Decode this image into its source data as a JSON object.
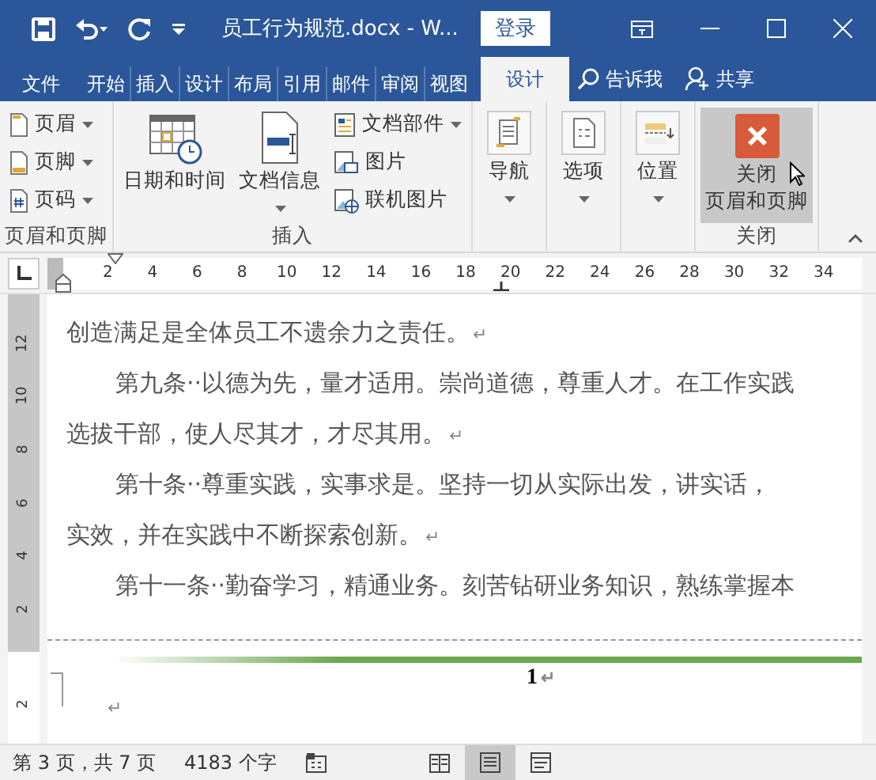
{
  "window": {
    "title": "员工行为规范.docx  -  W...",
    "sign_in": "登录"
  },
  "tabs": [
    {
      "label": "文件",
      "selected": false
    },
    {
      "label": "开始",
      "selected": false
    },
    {
      "label": "插入",
      "selected": false
    },
    {
      "label": "设计",
      "selected": false
    },
    {
      "label": "布局",
      "selected": false
    },
    {
      "label": "引用",
      "selected": false
    },
    {
      "label": "邮件",
      "selected": false
    },
    {
      "label": "审阅",
      "selected": false
    },
    {
      "label": "视图",
      "selected": false
    },
    {
      "label": "设计",
      "selected": true
    }
  ],
  "tell_me": "告诉我",
  "share": "共享",
  "ribbon": {
    "groups": [
      {
        "label": "页眉和页脚",
        "items": [
          {
            "label": "页眉",
            "kind": "small",
            "dropdown": true
          },
          {
            "label": "页脚",
            "kind": "small",
            "dropdown": true
          },
          {
            "label": "页码",
            "kind": "small",
            "dropdown": true
          }
        ]
      },
      {
        "label": "插入",
        "items": [
          {
            "label": "日期和时间",
            "kind": "large",
            "dropdown": false
          },
          {
            "label": "文档信息",
            "kind": "large",
            "dropdown": true
          },
          {
            "label": "文档部件",
            "kind": "small",
            "dropdown": true
          },
          {
            "label": "图片",
            "kind": "small",
            "dropdown": false
          },
          {
            "label": "联机图片",
            "kind": "small",
            "dropdown": false
          }
        ]
      },
      {
        "items": [
          {
            "label": "导航",
            "kind": "large",
            "dropdown": true
          }
        ]
      },
      {
        "items": [
          {
            "label": "选项",
            "kind": "large",
            "dropdown": true
          }
        ]
      },
      {
        "items": [
          {
            "label": "位置",
            "kind": "large",
            "dropdown": true
          }
        ]
      },
      {
        "label": "关闭",
        "items": [
          {
            "lines": [
              "关闭",
              "页眉和页脚"
            ],
            "kind": "large",
            "dropdown": false,
            "hovered": true
          }
        ]
      }
    ]
  },
  "ruler": {
    "ticks": [
      "2",
      "4",
      "6",
      "8",
      "10",
      "12",
      "14",
      "16",
      "18",
      "20",
      "22",
      "24",
      "26",
      "28",
      "30",
      "32",
      "34"
    ]
  },
  "vertical_ruler": {
    "ticks": [
      "12",
      "10",
      "8",
      "6",
      "4",
      "2",
      "2"
    ]
  },
  "document": {
    "lines": [
      {
        "text": "创造满足是全体员工不遗余力之责任。",
        "indented": false,
        "mark": "↵"
      },
      {
        "text": "第九条··以德为先，量才适用。崇尚道德，尊重人才。在工作实践",
        "indented": true
      },
      {
        "text": "选拔干部，使人尽其才，才尽其用。",
        "indented": false,
        "mark": "↵"
      },
      {
        "text": "第十条··尊重实践，实事求是。坚持一切从实际出发，讲实话，",
        "indented": true
      },
      {
        "text": "实效，并在实践中不断探索创新。",
        "indented": false,
        "mark": "↵"
      },
      {
        "text": "第十一条··勤奋学习，精通业务。刻苦钻研业务知识，熟练掌握本",
        "indented": true
      }
    ],
    "footer": {
      "page_number": "1",
      "mark": "↵",
      "empty_mark": "↵"
    }
  },
  "status_bar": {
    "page": "第 3 页，共 7 页",
    "words": "4183 个字",
    "views": [
      {
        "kind": "read",
        "selected": false
      },
      {
        "kind": "print",
        "selected": true
      },
      {
        "kind": "web",
        "selected": false
      }
    ]
  }
}
